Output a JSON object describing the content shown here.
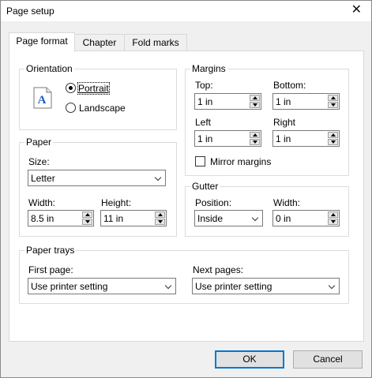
{
  "window": {
    "title": "Page setup",
    "close_glyph": "✕"
  },
  "tabs": [
    {
      "label": "Page format",
      "active": true
    },
    {
      "label": "Chapter",
      "active": false
    },
    {
      "label": "Fold marks",
      "active": false
    }
  ],
  "orientation": {
    "title": "Orientation",
    "icon_letter": "A",
    "portrait_label": "Portrait",
    "landscape_label": "Landscape",
    "selected": "Portrait"
  },
  "margins": {
    "title": "Margins",
    "top_label": "Top:",
    "top_value": "1 in",
    "bottom_label": "Bottom:",
    "bottom_value": "1 in",
    "left_label": "Left",
    "left_value": "1 in",
    "right_label": "Right",
    "right_value": "1 in",
    "mirror_label": "Mirror margins",
    "mirror_checked": false
  },
  "paper": {
    "title": "Paper",
    "size_label": "Size:",
    "size_value": "Letter",
    "width_label": "Width:",
    "width_value": "8.5 in",
    "height_label": "Height:",
    "height_value": "11 in"
  },
  "gutter": {
    "title": "Gutter",
    "position_label": "Position:",
    "position_value": "Inside",
    "width_label": "Width:",
    "width_value": "0 in"
  },
  "paper_trays": {
    "title": "Paper trays",
    "first_label": "First page:",
    "first_value": "Use printer setting",
    "next_label": "Next pages:",
    "next_value": "Use printer setting"
  },
  "buttons": {
    "ok": "OK",
    "cancel": "Cancel"
  },
  "colors": {
    "accent": "#0078d7",
    "icon_blue": "#1f5fbf"
  }
}
